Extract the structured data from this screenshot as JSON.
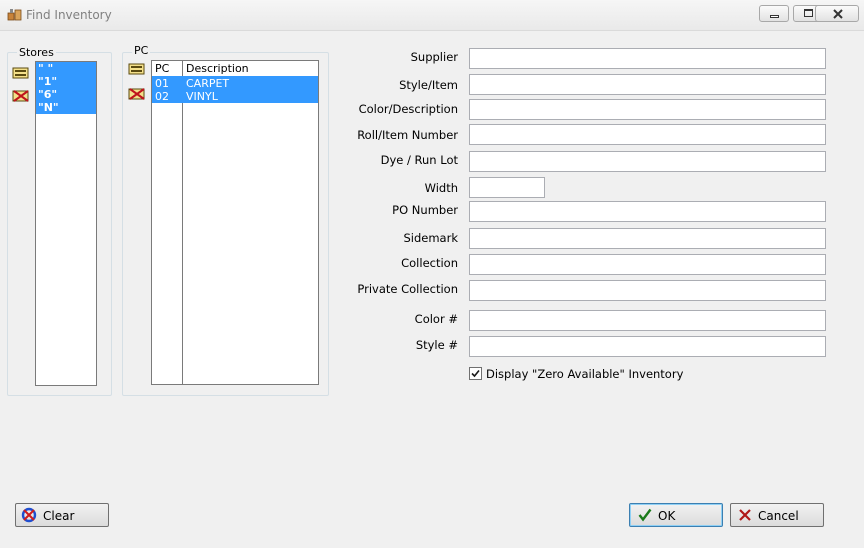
{
  "window": {
    "title": "Find Inventory"
  },
  "stores": {
    "group_label": "Stores",
    "items": [
      "\" \"",
      "\"1\"",
      "\"6\"",
      "\"N\""
    ]
  },
  "pc": {
    "group_label": "PC",
    "col_pc": "PC",
    "col_desc": "Description",
    "rows": [
      {
        "code": "01",
        "desc": "CARPET"
      },
      {
        "code": "02",
        "desc": "VINYL"
      }
    ]
  },
  "fields": {
    "supplier": "Supplier",
    "style_item": "Style/Item",
    "color_description": "Color/Description",
    "roll_item_number": "Roll/Item Number",
    "dye_run_lot": "Dye / Run Lot",
    "width": "Width",
    "po_number": "PO Number",
    "sidemark": "Sidemark",
    "collection": "Collection",
    "private_collection": "Private Collection",
    "color_num": "Color #",
    "style_num": "Style #"
  },
  "display_zero": {
    "label": "Display \"Zero Available\" Inventory",
    "checked": true
  },
  "buttons": {
    "clear": "Clear",
    "ok": "OK",
    "cancel": "Cancel"
  }
}
